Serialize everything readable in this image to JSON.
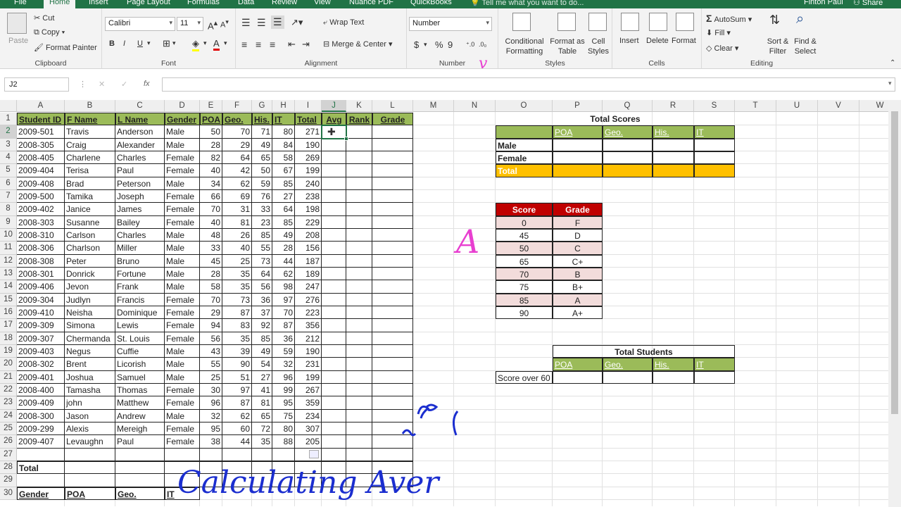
{
  "tabs": [
    "File",
    "Home",
    "Insert",
    "Page Layout",
    "Formulas",
    "Data",
    "Review",
    "View",
    "Nuance PDF",
    "QuickBooks"
  ],
  "tell_me": "Tell me what you want to do...",
  "user": "Finton Paul",
  "share": "Share",
  "clipboard": {
    "paste": "Paste",
    "cut": "Cut",
    "copy": "Copy",
    "format_painter": "Format Painter",
    "label": "Clipboard"
  },
  "font": {
    "name": "Calibri",
    "size": "11",
    "bold": "B",
    "italic": "I",
    "underline": "U",
    "font_color_glyph": "A",
    "label": "Font"
  },
  "alignment": {
    "wrap": "Wrap Text",
    "merge": "Merge & Center",
    "label": "Alignment"
  },
  "number": {
    "format": "Number",
    "dollar": "$",
    "percent": "%",
    "comma": "9",
    "label": "Number"
  },
  "styles": {
    "cond": "Conditional Formatting",
    "table": "Format as Table",
    "cell": "Cell Styles",
    "label": "Styles"
  },
  "cells": {
    "insert": "Insert",
    "delete": "Delete",
    "format": "Format",
    "label": "Cells"
  },
  "editing": {
    "autosum": "AutoSum",
    "fill": "Fill",
    "clear": "Clear",
    "sort": "Sort & Filter",
    "find": "Find & Select",
    "label": "Editing"
  },
  "namebox": "J2",
  "fx": "fx",
  "columns": [
    "A",
    "B",
    "C",
    "D",
    "E",
    "F",
    "G",
    "H",
    "I",
    "J",
    "K",
    "L",
    "M",
    "N",
    "O",
    "P",
    "Q",
    "R",
    "S",
    "T",
    "U",
    "V",
    "W"
  ],
  "table_headers": [
    "Student ID",
    "F Name",
    "L Name",
    "Gender",
    "POA",
    "Geo.",
    "His.",
    "IT",
    "Total",
    "Avg",
    "Rank",
    "Grade"
  ],
  "students": [
    [
      "2009-501",
      "Travis",
      "Anderson",
      "Male",
      "50",
      "70",
      "71",
      "80",
      "271"
    ],
    [
      "2008-305",
      "Craig",
      "Alexander",
      "Male",
      "28",
      "29",
      "49",
      "84",
      "190"
    ],
    [
      "2008-405",
      "Charlene",
      "Charles",
      "Female",
      "82",
      "64",
      "65",
      "58",
      "269"
    ],
    [
      "2009-404",
      "Terisa",
      "Paul",
      "Female",
      "40",
      "42",
      "50",
      "67",
      "199"
    ],
    [
      "2009-408",
      "Brad",
      "Peterson",
      "Male",
      "34",
      "62",
      "59",
      "85",
      "240"
    ],
    [
      "2009-500",
      "Tamika",
      "Joseph",
      "Female",
      "66",
      "69",
      "76",
      "27",
      "238"
    ],
    [
      "2009-402",
      "Janice",
      "James",
      "Female",
      "70",
      "31",
      "33",
      "64",
      "198"
    ],
    [
      "2008-303",
      "Susanne",
      "Bailey",
      "Female",
      "40",
      "81",
      "23",
      "85",
      "229"
    ],
    [
      "2008-310",
      "Carlson",
      "Charles",
      "Male",
      "48",
      "26",
      "85",
      "49",
      "208"
    ],
    [
      "2008-306",
      "Charlson",
      "Miller",
      "Male",
      "33",
      "40",
      "55",
      "28",
      "156"
    ],
    [
      "2008-308",
      "Peter",
      "Bruno",
      "Male",
      "45",
      "25",
      "73",
      "44",
      "187"
    ],
    [
      "2008-301",
      "Donrick",
      "Fortune",
      "Male",
      "28",
      "35",
      "64",
      "62",
      "189"
    ],
    [
      "2009-406",
      "Jevon",
      "Frank",
      "Male",
      "58",
      "35",
      "56",
      "98",
      "247"
    ],
    [
      "2009-304",
      "Judlyn",
      "Francis",
      "Female",
      "70",
      "73",
      "36",
      "97",
      "276"
    ],
    [
      "2009-410",
      "Neisha",
      "Dominique",
      "Female",
      "29",
      "87",
      "37",
      "70",
      "223"
    ],
    [
      "2009-309",
      "Simona",
      "Lewis",
      "Female",
      "94",
      "83",
      "92",
      "87",
      "356"
    ],
    [
      "2009-307",
      "Chermanda",
      "St. Louis",
      "Female",
      "56",
      "35",
      "85",
      "36",
      "212"
    ],
    [
      "2009-403",
      "Negus",
      "Cuffie",
      "Male",
      "43",
      "39",
      "49",
      "59",
      "190"
    ],
    [
      "2008-302",
      "Brent",
      "Licorish",
      "Male",
      "55",
      "90",
      "54",
      "32",
      "231"
    ],
    [
      "2009-401",
      "Joshua",
      "Samuel",
      "Male",
      "25",
      "51",
      "27",
      "96",
      "199"
    ],
    [
      "2008-400",
      "Tamasha",
      "Thomas",
      "Female",
      "30",
      "97",
      "41",
      "99",
      "267"
    ],
    [
      "2009-409",
      "john",
      "Matthew",
      "Female",
      "96",
      "87",
      "81",
      "95",
      "359"
    ],
    [
      "2008-300",
      "Jason",
      "Andrew",
      "Male",
      "32",
      "62",
      "65",
      "75",
      "234"
    ],
    [
      "2009-299",
      "Alexis",
      "Mereigh",
      "Female",
      "95",
      "60",
      "72",
      "80",
      "307"
    ],
    [
      "2009-407",
      "Levaughn",
      "Paul",
      "Female",
      "38",
      "44",
      "35",
      "88",
      "205"
    ]
  ],
  "total_label": "Total",
  "bottom_headers": [
    "Gender",
    "POA",
    "Geo.",
    "IT"
  ],
  "total_scores": {
    "title": "Total Scores",
    "cols": [
      "POA",
      "Geo.",
      "His.",
      "IT"
    ],
    "rows": [
      "Male",
      "Female",
      "Total"
    ]
  },
  "grade_table": {
    "h_score": "Score",
    "h_grade": "Grade",
    "rows": [
      [
        "0",
        "F"
      ],
      [
        "45",
        "D"
      ],
      [
        "50",
        "C"
      ],
      [
        "65",
        "C+"
      ],
      [
        "70",
        "B"
      ],
      [
        "75",
        "B+"
      ],
      [
        "85",
        "A"
      ],
      [
        "90",
        "A+"
      ]
    ]
  },
  "total_students": {
    "title": "Total Students",
    "cols": [
      "POA",
      "Geo.",
      "His.",
      "IT"
    ],
    "row": "Score over 60"
  },
  "handwriting": {
    "title": "Calculating Aver",
    "letter": "A",
    "v": "v"
  },
  "colors": {
    "excel_green": "#217346",
    "header_green": "#9bbb59",
    "orange": "#ffc000",
    "red": "#c00000",
    "pink": "#f2dcdb",
    "ink": "#1b2ecf",
    "pen": "#e83fd0"
  }
}
